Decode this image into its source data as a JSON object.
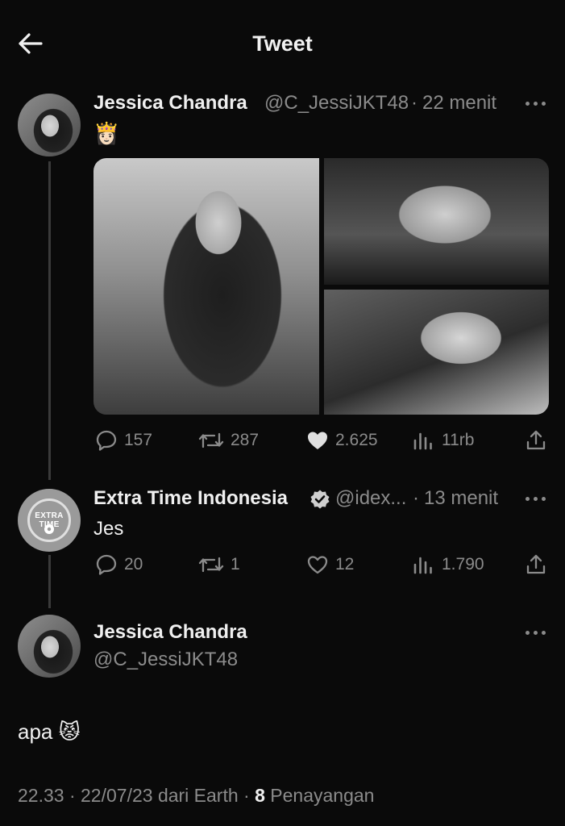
{
  "header": {
    "title": "Tweet",
    "back_icon": "arrow-left-icon"
  },
  "original_tweet": {
    "author_name": "Jessica Chandra",
    "handle": "@C_JessiJKT48",
    "separator": "·",
    "time_ago": "22 menit",
    "text": "👸🏻",
    "media_count": 3,
    "stats": {
      "replies": "157",
      "retweets": "287",
      "likes": "2.625",
      "views": "11rb"
    }
  },
  "reply": {
    "author_name": "Extra Time Indonesia",
    "verified": true,
    "handle": "@idex...",
    "separator": "·",
    "time_ago": "13 menit",
    "text": "Jes",
    "logo_text": "EXTRA TIME",
    "stats": {
      "replies": "20",
      "retweets": "1",
      "likes": "12",
      "views": "1.790"
    }
  },
  "focused_tweet": {
    "author_name": "Jessica Chandra",
    "handle": "@C_JessiJKT48",
    "text": "apa 😾",
    "footer": {
      "time": "22.33",
      "sep1": "·",
      "date": "22/07/23",
      "source": "dari Earth",
      "sep2": "·",
      "views_count": "8",
      "views_label": "Penayangan"
    }
  },
  "colors": {
    "background": "#0a0a0a",
    "text": "#e7e9ea",
    "muted": "#8b8b8b",
    "line": "#3a3a3a"
  }
}
